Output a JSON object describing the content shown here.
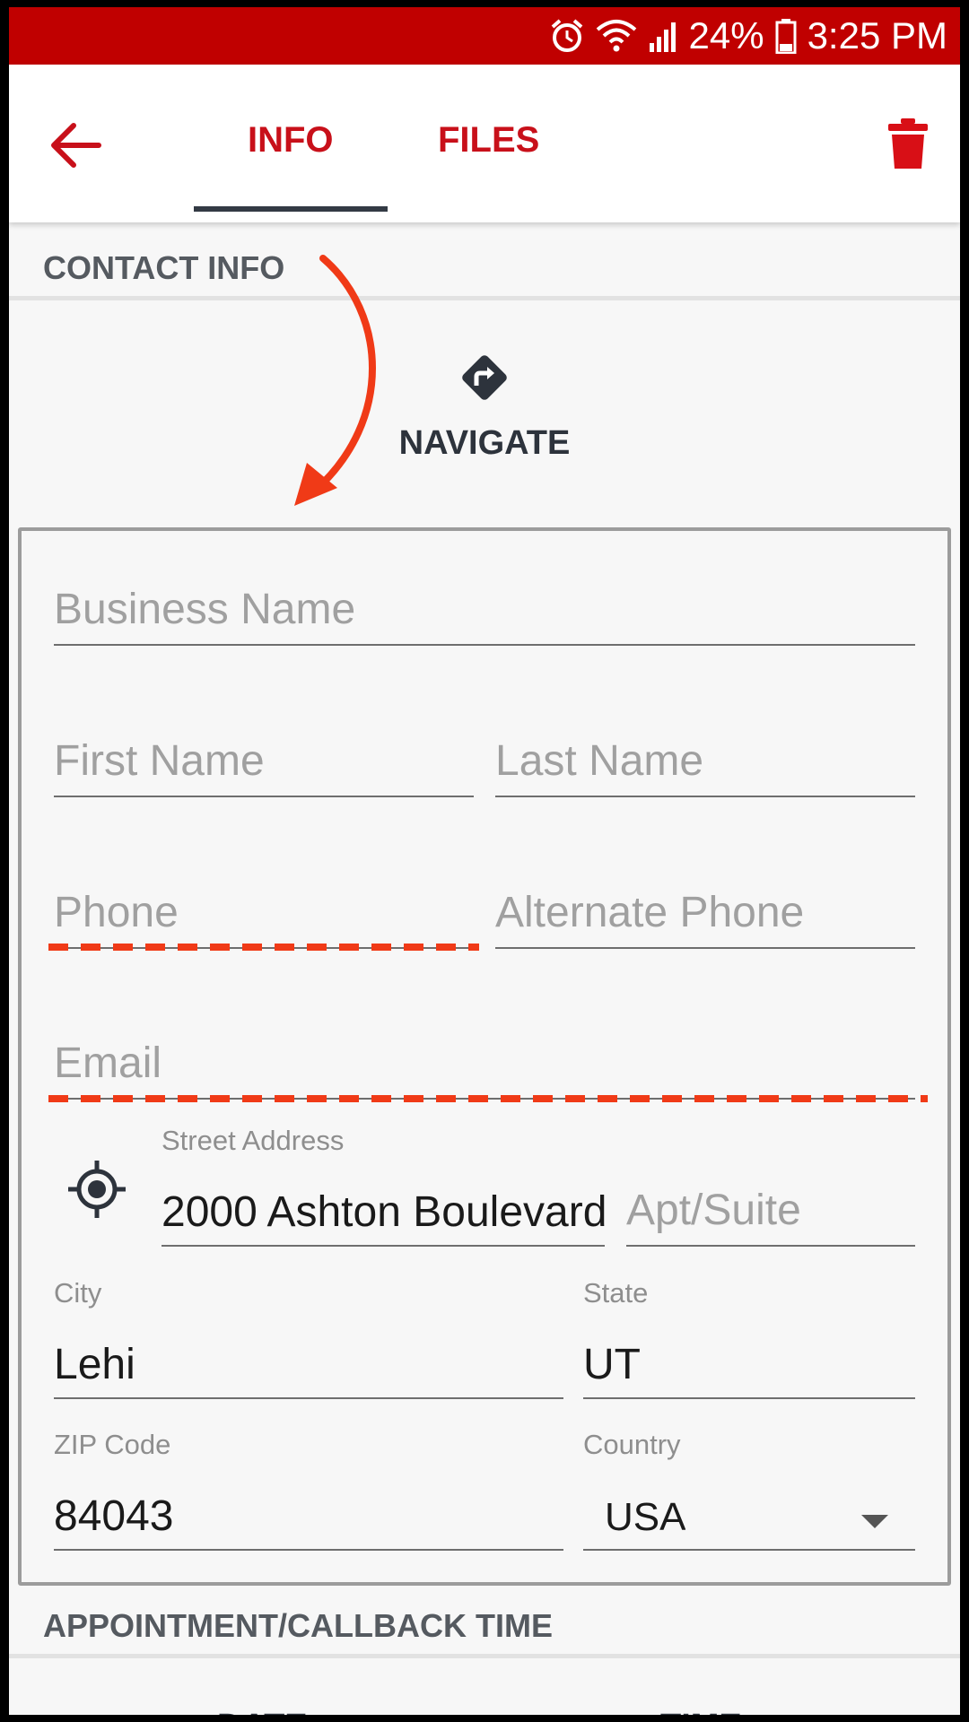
{
  "status_bar": {
    "battery": "24%",
    "time": "3:25 PM"
  },
  "header": {
    "tabs": [
      {
        "label": "INFO"
      },
      {
        "label": "FILES"
      }
    ]
  },
  "contact": {
    "section_title": "CONTACT INFO",
    "navigate_label": "NAVIGATE",
    "fields": {
      "business_name": {
        "placeholder": "Business Name"
      },
      "first_name": {
        "placeholder": "First Name"
      },
      "last_name": {
        "placeholder": "Last Name"
      },
      "phone": {
        "placeholder": "Phone"
      },
      "alternate_phone": {
        "placeholder": "Alternate Phone"
      },
      "email": {
        "placeholder": "Email"
      },
      "street_address": {
        "label": "Street Address",
        "value": "2000 Ashton Boulevard"
      },
      "apt_suite": {
        "placeholder": "Apt/Suite"
      },
      "city": {
        "label": "City",
        "value": "Lehi"
      },
      "state": {
        "label": "State",
        "value": "UT"
      },
      "zip": {
        "label": "ZIP Code",
        "value": "84043"
      },
      "country": {
        "label": "Country",
        "value": "USA"
      }
    }
  },
  "appointment": {
    "section_title": "APPOINTMENT/CALLBACK TIME",
    "col_date": "DATE",
    "col_time": "TIME"
  },
  "colors": {
    "status_bar": "#c00000",
    "accent": "#c8101a",
    "annotation": "#f03a17",
    "tab_indicator": "#333a44"
  },
  "icons": [
    "alarm-icon",
    "wifi-icon",
    "signal-icon",
    "battery-icon",
    "back-arrow-icon",
    "trash-icon",
    "navigate-icon",
    "locate-icon",
    "dropdown-arrow-icon"
  ]
}
